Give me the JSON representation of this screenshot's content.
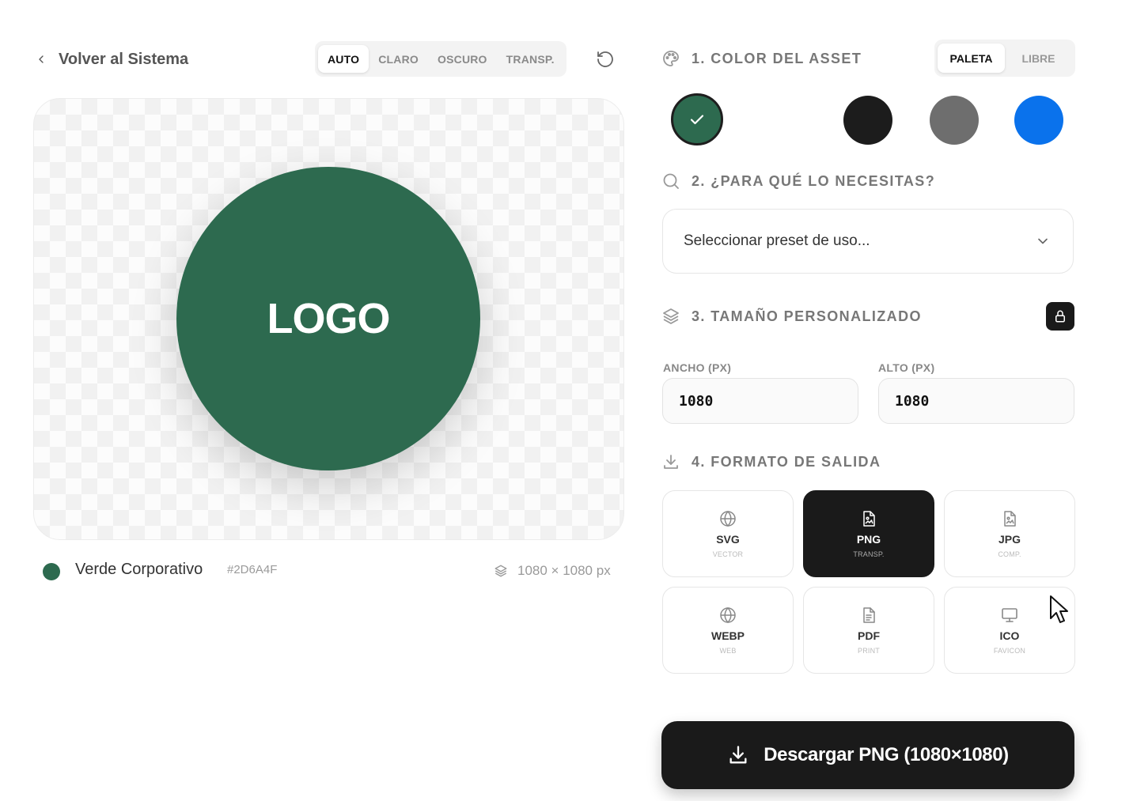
{
  "nav": {
    "back_label": "Volver al Sistema"
  },
  "theme_options": [
    {
      "label": "AUTO",
      "active": true
    },
    {
      "label": "CLARO",
      "active": false
    },
    {
      "label": "OSCURO",
      "active": false
    },
    {
      "label": "TRANSP.",
      "active": false
    }
  ],
  "preview": {
    "logo_text": "LOGO",
    "color_name": "Verde Corporativo",
    "color_hex": "#2D6A4F",
    "dimensions": "1080 × 1080 px"
  },
  "section1": {
    "title": "1. COLOR DEL ASSET",
    "modes": [
      {
        "label": "PALETA",
        "active": true
      },
      {
        "label": "LIBRE",
        "active": false
      }
    ],
    "swatches": [
      {
        "color": "#2d6a4f",
        "selected": true
      },
      {
        "color": "#1c1c1c",
        "selected": false
      },
      {
        "color": "#6e6e6e",
        "selected": false
      },
      {
        "color": "#0a72ec",
        "selected": false
      }
    ]
  },
  "section2": {
    "title": "2. ¿PARA QUÉ LO NECESITAS?",
    "select_placeholder": "Seleccionar preset de uso..."
  },
  "section3": {
    "title": "3. TAMAÑO PERSONALIZADO",
    "width_label": "ANCHO (PX)",
    "width_value": "1080",
    "height_label": "ALTO (PX)",
    "height_value": "1080"
  },
  "section4": {
    "title": "4. FORMATO DE SALIDA",
    "formats": [
      {
        "name": "SVG",
        "sub": "VECTOR",
        "icon": "globe-icon",
        "active": false
      },
      {
        "name": "PNG",
        "sub": "TRANSP.",
        "icon": "image-file-icon",
        "active": true
      },
      {
        "name": "JPG",
        "sub": "COMP.",
        "icon": "image-file-icon",
        "active": false
      },
      {
        "name": "WEBP",
        "sub": "WEB",
        "icon": "globe-icon",
        "active": false
      },
      {
        "name": "PDF",
        "sub": "PRINT",
        "icon": "document-icon",
        "active": false
      },
      {
        "name": "ICO",
        "sub": "FAVICON",
        "icon": "monitor-icon",
        "active": false
      }
    ]
  },
  "download": {
    "label": "Descargar PNG (1080×1080)"
  },
  "colors": {
    "accent": "#2d6a4f",
    "dark": "#1a1a1a"
  }
}
